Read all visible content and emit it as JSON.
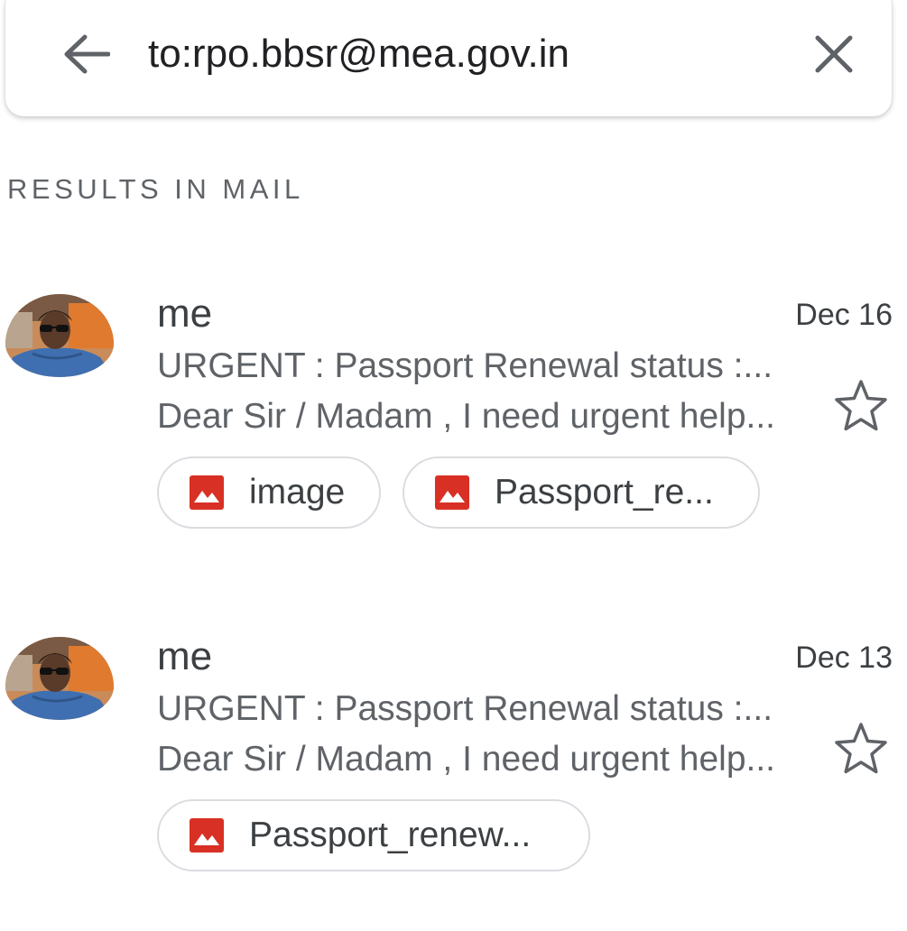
{
  "search": {
    "query": "to:rpo.bbsr@mea.gov.in",
    "back_icon": "arrow-back-icon",
    "clear_icon": "close-icon"
  },
  "section_header": "RESULTS IN MAIL",
  "emails": [
    {
      "sender": "me",
      "date": "Dec 16",
      "subject": "URGENT : Passport Renewal status :...",
      "snippet": "Dear Sir / Madam , I need urgent help...",
      "starred": false,
      "attachments": [
        {
          "label": "image",
          "icon": "image-icon"
        },
        {
          "label": "Passport_re...",
          "icon": "image-icon"
        }
      ]
    },
    {
      "sender": "me",
      "date": "Dec 13",
      "subject": "URGENT : Passport Renewal status :...",
      "snippet": "Dear Sir / Madam , I need urgent help...",
      "starred": false,
      "attachments": [
        {
          "label": "Passport_renew...",
          "icon": "image-icon"
        }
      ]
    }
  ],
  "colors": {
    "attachment_icon": "#d93025",
    "secondary_text": "#5f6368",
    "star_outline": "#5f6368"
  }
}
